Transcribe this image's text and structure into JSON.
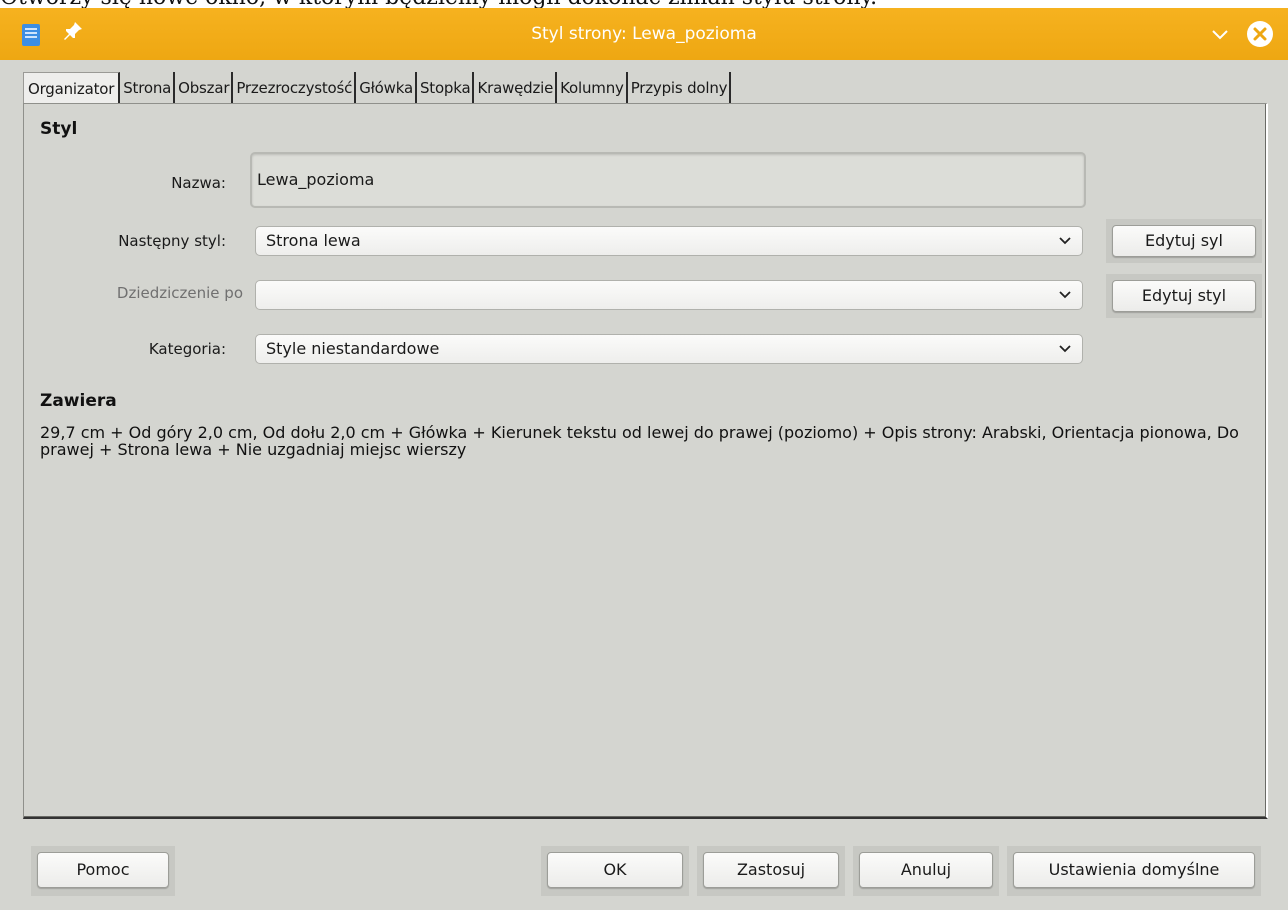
{
  "background_caption": "Otworzy się nowe okno, w którym będziemy mogli dokonać zmian stylu strony.",
  "window": {
    "title": "Styl strony: Lewa_pozioma",
    "title_color": "#f3ab18"
  },
  "tabs": [
    {
      "label": "Organizator",
      "active": true
    },
    {
      "label": "Strona"
    },
    {
      "label": "Obszar"
    },
    {
      "label": "Przezroczystość"
    },
    {
      "label": "Główka"
    },
    {
      "label": "Stopka"
    },
    {
      "label": "Krawędzie"
    },
    {
      "label": "Kolumny"
    },
    {
      "label": "Przypis dolny"
    }
  ],
  "style_section": {
    "heading": "Styl",
    "name_label": "Nazwa:",
    "name_value": "Lewa_pozioma",
    "next_style_label": "Następny styl:",
    "next_style_value": "Strona lewa",
    "edit_next_button": "Edytuj syl",
    "inherit_label": "Dziedziczenie po",
    "inherit_value": "",
    "edit_inherit_button": "Edytuj styl",
    "category_label": "Kategoria:",
    "category_value": "Style niestandardowe"
  },
  "contains_section": {
    "heading": "Zawiera",
    "text": "29,7 cm + Od góry 2,0 cm, Od dołu 2,0 cm + Główka + Kierunek tekstu od lewej do prawej (poziomo) + Opis strony: Arabski, Orientacja pionowa, Do prawej + Strona lewa + Nie uzgadniaj miejsc wierszy"
  },
  "buttons": {
    "help": "Pomoc",
    "ok": "OK",
    "apply": "Zastosuj",
    "cancel": "Anuluj",
    "reset": "Ustawienia domyślne"
  },
  "icons": {
    "app": "writer-document-icon",
    "pin": "pin-icon",
    "collapse": "chevron-down-icon",
    "close": "close-circle-icon"
  }
}
